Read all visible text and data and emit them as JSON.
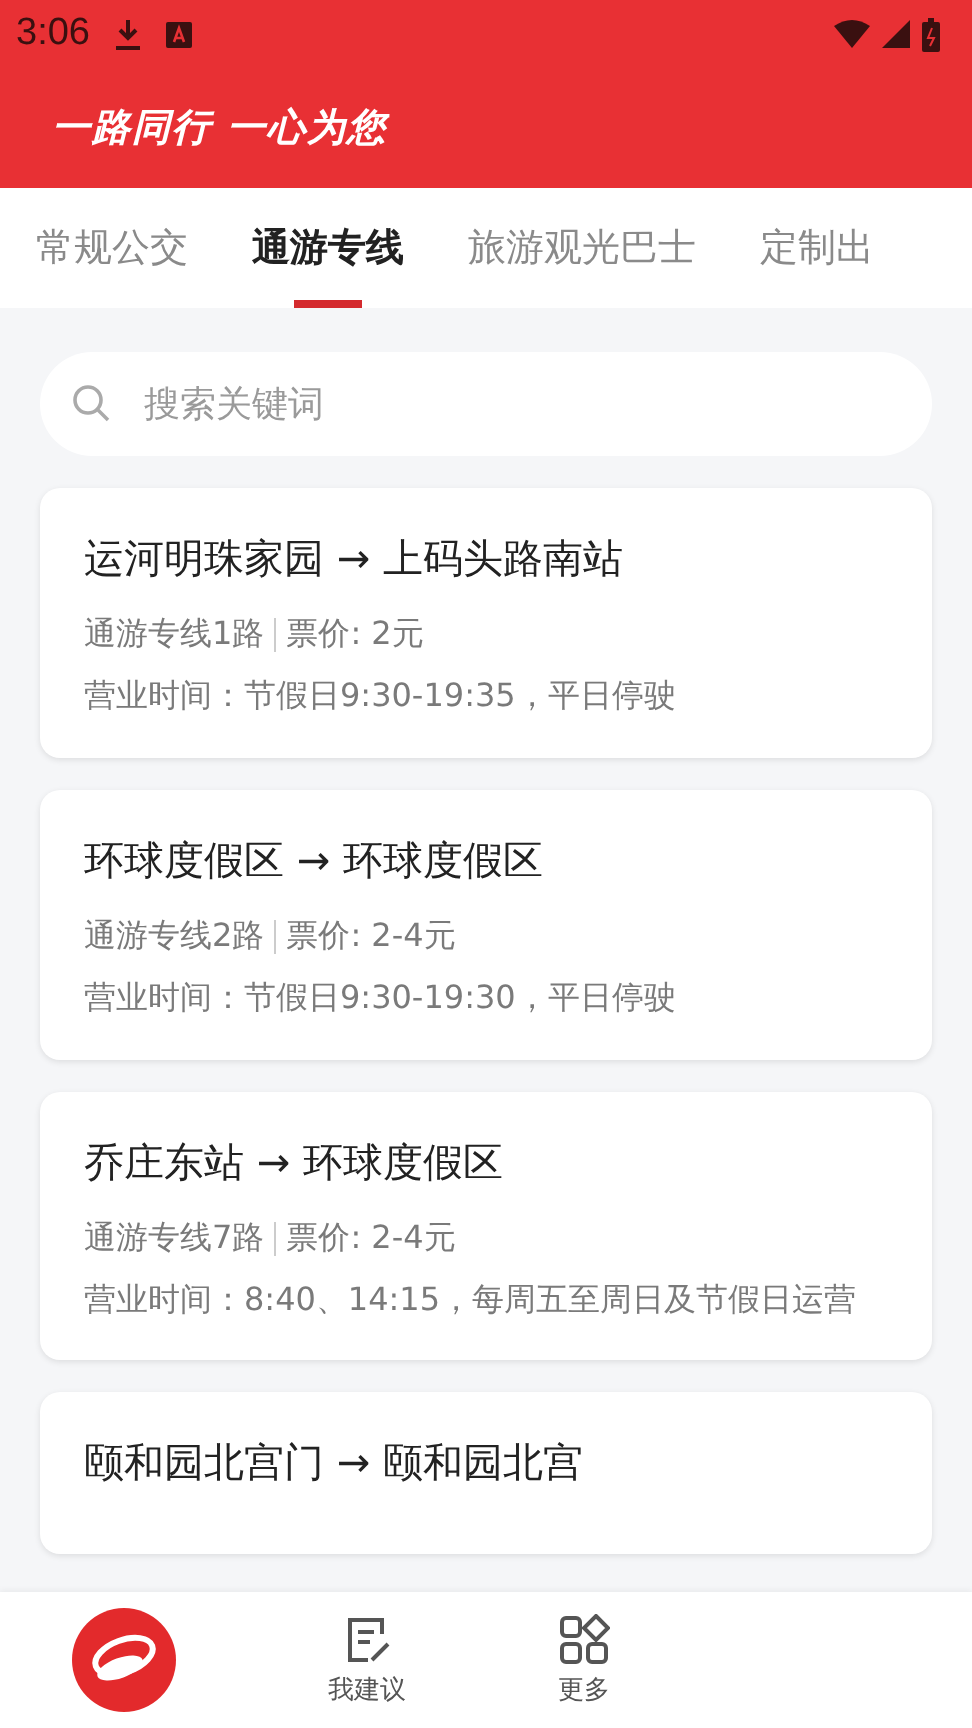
{
  "status_bar": {
    "time": "3:06"
  },
  "header": {
    "slogan": "一路同行 一心为您"
  },
  "tabs": [
    {
      "label": "常规公交",
      "selected": false
    },
    {
      "label": "通游专线",
      "selected": true
    },
    {
      "label": "旅游观光巴士",
      "selected": false
    },
    {
      "label": "定制出",
      "selected": false
    }
  ],
  "search": {
    "placeholder": "搜索关键词"
  },
  "routes": [
    {
      "title": "运河明珠家园 → 上码头路南站",
      "line": "通游专线1路",
      "fare": "票价: 2元",
      "hours": "营业时间：节假日9:30-19:35，平日停驶"
    },
    {
      "title": "环球度假区 → 环球度假区",
      "line": "通游专线2路",
      "fare": "票价: 2-4元",
      "hours": "营业时间：节假日9:30-19:30，平日停驶"
    },
    {
      "title": "乔庄东站 → 环球度假区",
      "line": "通游专线7路",
      "fare": "票价: 2-4元",
      "hours": "营业时间：8:40、14:15，每周五至周日及节假日运营"
    },
    {
      "title": "颐和园北宫门 → 颐和园北宫"
    }
  ],
  "bottom_nav": [
    {
      "label": "我建议",
      "kind": "suggest"
    },
    {
      "label": "更多",
      "kind": "more"
    }
  ]
}
